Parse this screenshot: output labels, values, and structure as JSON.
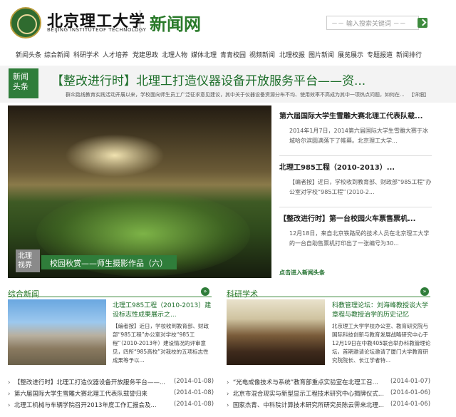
{
  "header": {
    "logo_cn": "北京理工大学",
    "logo_en": "BEIJING INSTITUTEOF TECHNOLOGY",
    "site_name": "新闻网",
    "search_placeholder": "输入搜索关键词"
  },
  "nav": [
    "新闻头条",
    "综合新闻",
    "科研学术",
    "人才培养",
    "党建思政",
    "北理人物",
    "媒体北理",
    "青青校园",
    "视频新闻",
    "北理校报",
    "图片新闻",
    "展览展示",
    "专题报道",
    "新闻排行"
  ],
  "headline": {
    "tag_line1": "新闻",
    "tag_line2": "头条",
    "title": "【整改进行时】北理工打造仪器设备开放服务平台——资...",
    "summary": "群众路线教育实践活动开展以来，学校面向师生员工广泛征求意见建议，其中关于仪器设备资源分布不均、使用效率不高成为其中一项热点问题，如何在...",
    "more": "【详细】"
  },
  "photo": {
    "tag_line1": "北理",
    "tag_line2": "视界",
    "caption": "校园秋赏——师生摄影作品（六）",
    "more": "点击进入新闻头条"
  },
  "side_news": [
    {
      "title": "第六届国际大学生雪雕大赛北理工代表队载...",
      "body": "2014年1月7日，2014第六届国际大学生雪雕大赛于冰城哈尔滨圆满落下了帷幕。北京理工大学..."
    },
    {
      "title": "北理工985工程（2010-2013）...",
      "body": "【编者按】近日，学校收到教育部、财政部“985工程”办公室对学校“985工程”（2010-2..."
    },
    {
      "title": "【整改进行时】第一台校园火车票售票机...",
      "body": "12月18日，来自北京铁路局的技术人员在北京理工大学的一台自助售票机打印出了一张编号为30..."
    }
  ],
  "sections": {
    "news_title": "综合新闻",
    "research_title": "科研学术",
    "more_icon": "»"
  },
  "feature_news": {
    "title": "北理工985工程（2010-2013）建设标志性成果展示之...",
    "body": "【编者按】近日，学校收到教育部、财政部“985工程”办公室对学校“985工程”（2010-2013年）建设情况的评审意见，四所“985高校”对我校的五项标志性成果等予以..."
  },
  "feature_research": {
    "title": "科教管理论坛：刘海峰教授谈大学章程与教授治学的历史记忆",
    "body": "北京理工大学学校办公室、教育研究院与国际科技创新与教育发展战略研究中心于12月19日在中教405联合举办科教管理论坛，首期邀请论坛邀请了厦门大学教育研究院院长、长江学者特..."
  },
  "news_list": [
    {
      "title": "【整改进行时】北理工打造仪器设备开放服务平台——...",
      "date": "(2014-01-08)"
    },
    {
      "title": "第六届国际大学生雪雕大赛北理工代表队载誉归来",
      "date": "(2014-01-08)"
    },
    {
      "title": "北理工机械与车辆学院召开2013年度工作汇报会及...",
      "date": "(2014-01-08)"
    }
  ],
  "research_list": [
    {
      "title": "“光电成像技术与系统”教育部重点实验室在北理工召...",
      "date": "(2014-01-07)"
    },
    {
      "title": "北京市混合现实与新型显示工程技术研究中心揭牌仪式...",
      "date": "(2014-01-06)"
    },
    {
      "title": "国家杰青、中科院计算技术研究所研究员陈云霁来北理...",
      "date": "(2014-01-06)"
    }
  ]
}
